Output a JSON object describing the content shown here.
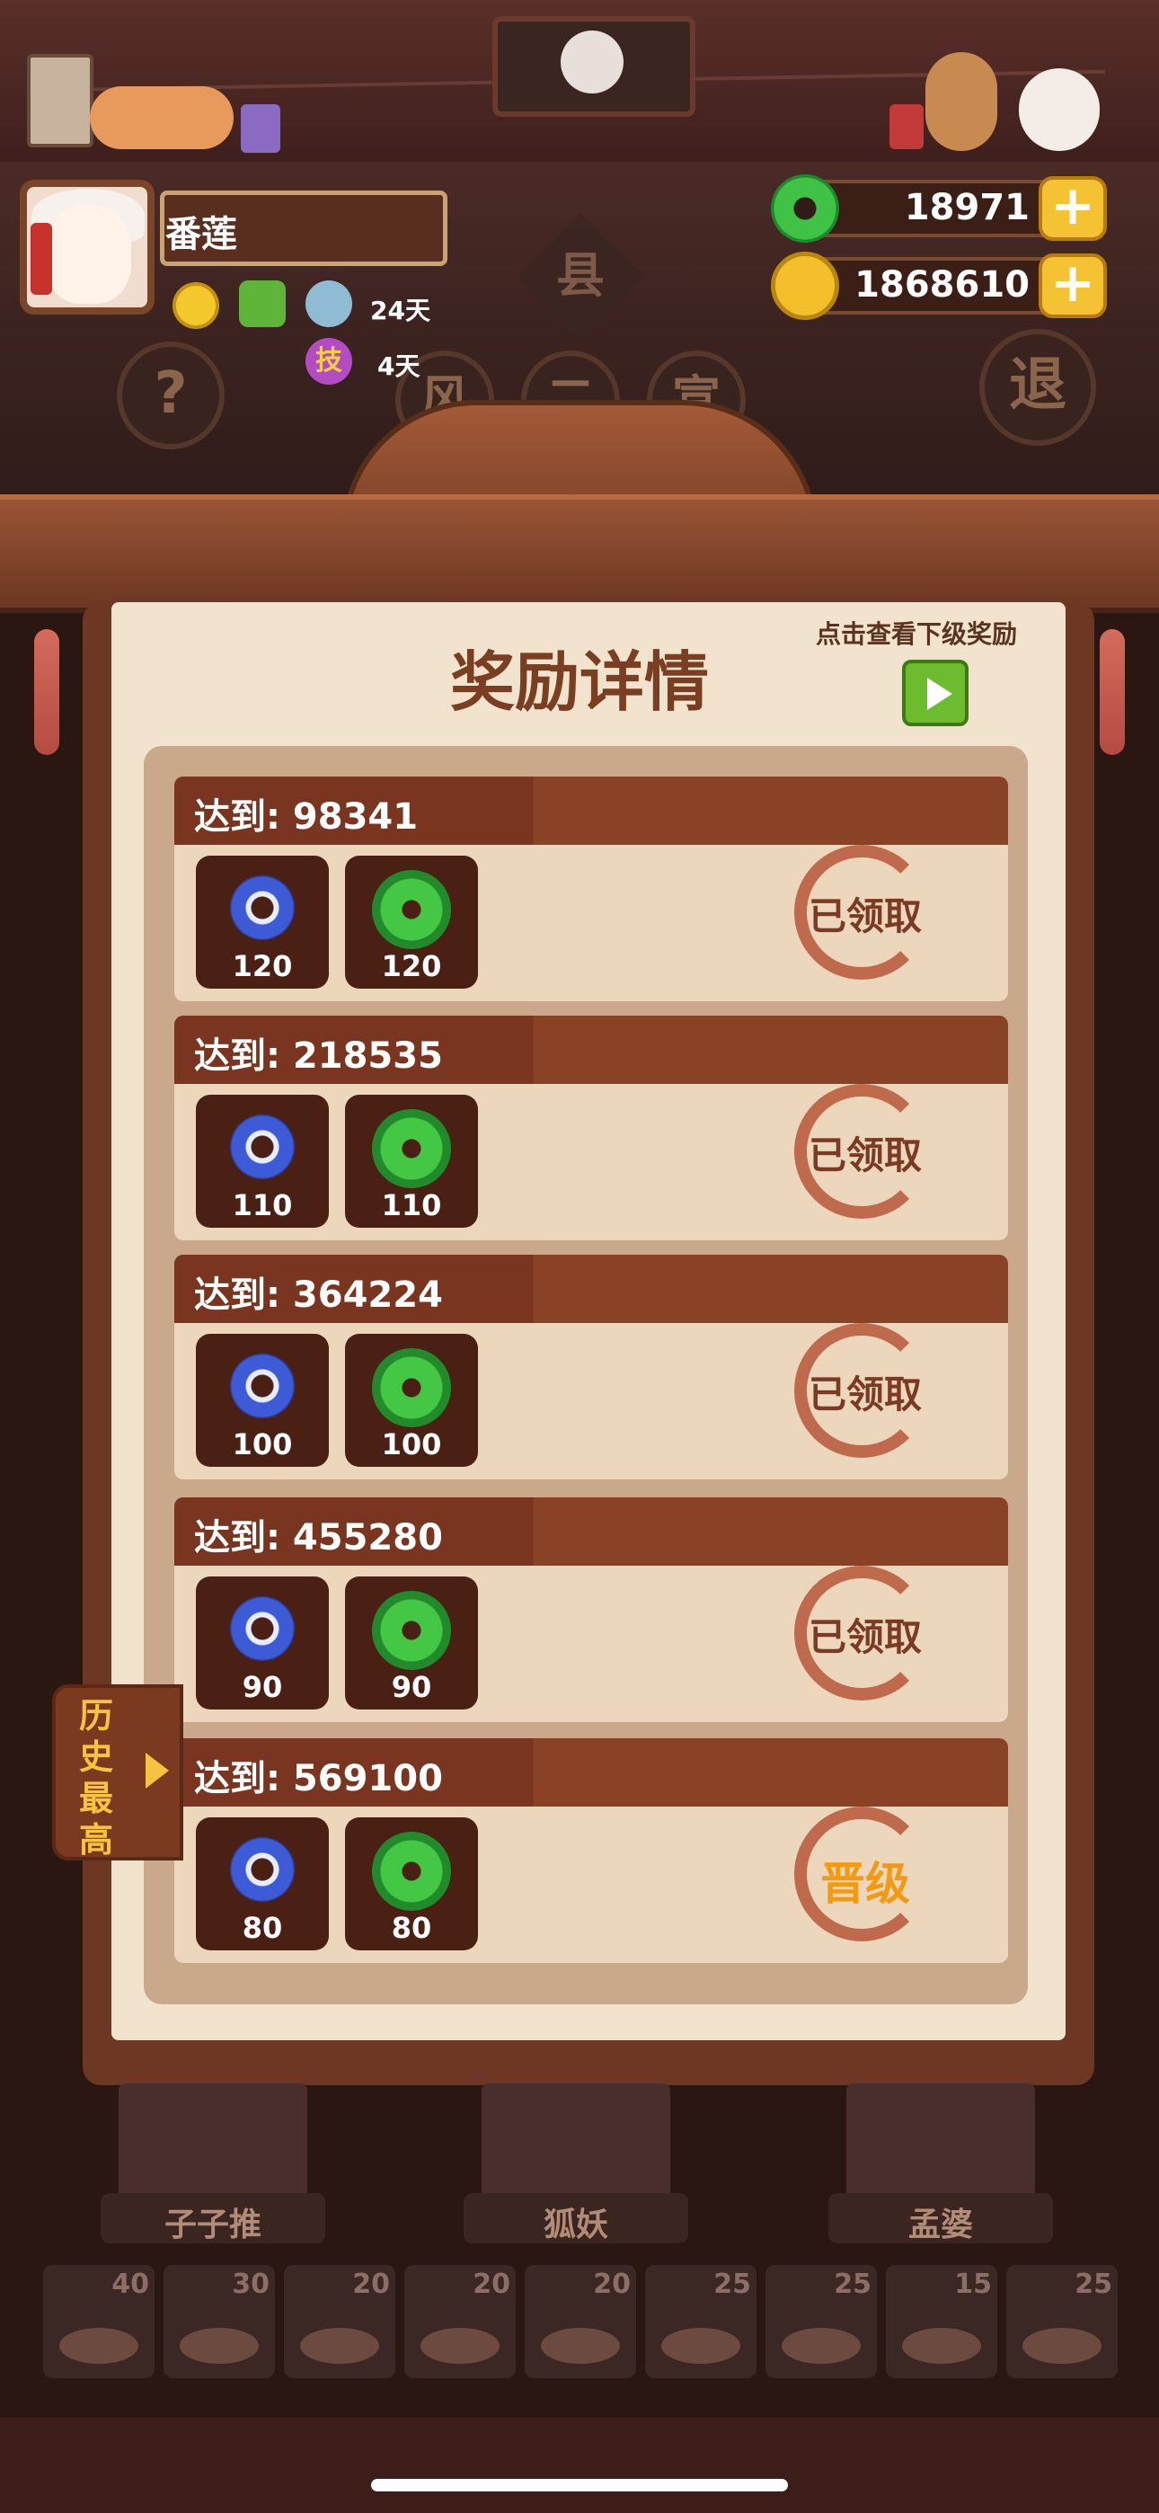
{
  "player": {
    "name": "番莲",
    "buff_days": [
      "24天",
      "4天"
    ],
    "skill_badge": "技"
  },
  "currency": [
    {
      "name": "jade",
      "value": "18971",
      "icon": "jade-ring-icon"
    },
    {
      "name": "coin",
      "value": "1868610",
      "icon": "gold-coin-icon"
    }
  ],
  "header_buttons": {
    "help": "?",
    "exit": "退",
    "sign": "县",
    "tabs": [
      "风",
      "二",
      "宣"
    ]
  },
  "panel": {
    "title": "奖励详情",
    "hint": "点击查看下级奖励",
    "rewards": [
      {
        "title": "达到: 98341",
        "blue": "120",
        "green": "120",
        "status": "已领取"
      },
      {
        "title": "达到: 218535",
        "blue": "110",
        "green": "110",
        "status": "已领取"
      },
      {
        "title": "达到: 364224",
        "blue": "100",
        "green": "100",
        "status": "已领取"
      },
      {
        "title": "达到: 455280",
        "blue": "90",
        "green": "90",
        "status": "已领取"
      },
      {
        "title": "达到: 569100",
        "blue": "80",
        "green": "80",
        "status": "晋级"
      }
    ]
  },
  "side_tab": {
    "text": "历史最高"
  },
  "characters": [
    "子子推",
    "狐妖",
    "孟婆"
  ],
  "dishes": [
    "40",
    "30",
    "20",
    "20",
    "20",
    "25",
    "25",
    "15",
    "25"
  ],
  "colors": {
    "accent_gold": "#f5c234",
    "wood": "#8a4226",
    "parchment": "#f1e3cd",
    "stamp_red": "#b9573a"
  }
}
